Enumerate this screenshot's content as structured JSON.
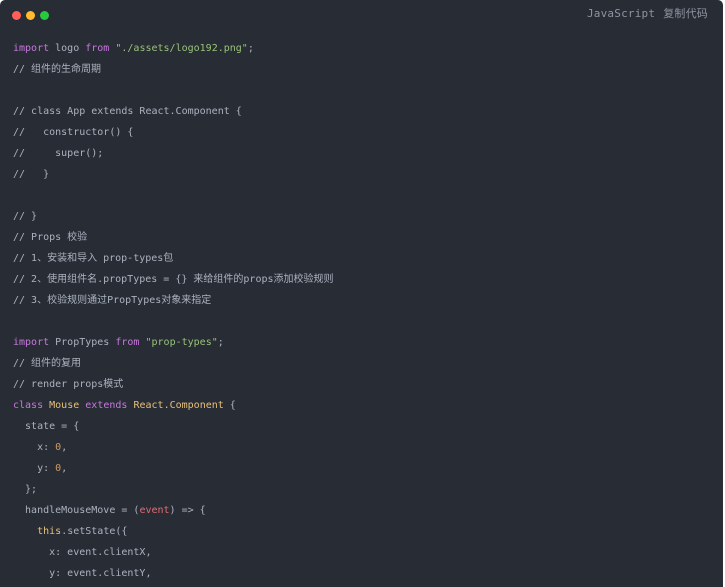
{
  "header": {
    "language": "JavaScript",
    "copy_label": "复制代码"
  },
  "code": {
    "l1": {
      "kw1": "import",
      "t1": " logo ",
      "kw2": "from",
      "t2": " ",
      "s1": "\"./assets/logo192.png\"",
      "t3": ";"
    },
    "l2": "// 组件的生命周期",
    "l3": "",
    "l4": "// class App extends React.Component {",
    "l5": "//   constructor() {",
    "l6": "//     super();",
    "l7": "//   }",
    "l8": "",
    "l9": "// }",
    "l10": "// Props 校验",
    "l11": "// 1、安装和导入 prop-types包",
    "l12": "// 2、使用组件名.propTypes = {} 来给组件的props添加校验规则",
    "l13": "// 3、校验规则通过PropTypes对象来指定",
    "l14": "",
    "l15": {
      "kw1": "import",
      "t1": " PropTypes ",
      "kw2": "from",
      "t2": " ",
      "s1": "\"prop-types\"",
      "t3": ";"
    },
    "l16": "// 组件的复用",
    "l17": "// render props模式",
    "l18": {
      "kw1": "class",
      "t1": " ",
      "c1": "Mouse",
      "t2": " ",
      "kw2": "extends",
      "t3": " ",
      "c2": "React.Component",
      "t4": " {"
    },
    "l19": "  state = {",
    "l20": {
      "t1": "    x",
      "t2": ": ",
      "n1": "0",
      "t3": ","
    },
    "l21": {
      "t1": "    y",
      "t2": ": ",
      "n1": "0",
      "t3": ","
    },
    "l22": "  };",
    "l23": {
      "t1": "  handleMouseMove = (",
      "p1": "event",
      "t2": ") => {"
    },
    "l24": {
      "t1": "    ",
      "th": "this",
      "t2": ".setState({"
    },
    "l25": "      x: event.clientX,",
    "l26": "      y: event.clientY,"
  }
}
